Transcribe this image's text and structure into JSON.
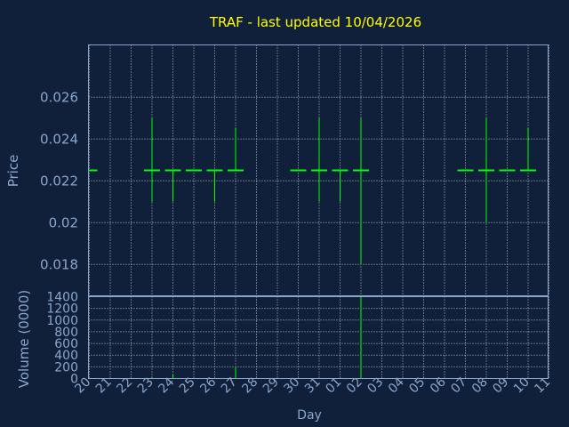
{
  "chart_data": {
    "type": "ohlc",
    "title": "TRAF - last updated 10/04/2026",
    "xlabel": "Day",
    "colors": {
      "background": "#10203a",
      "title": "#ffff00",
      "axis_text": "#8aa6cc",
      "price": "#00ff00",
      "volume": "#00ff00",
      "grid": "#d0d8e4"
    },
    "grid": true,
    "x_tick_labels": [
      "20",
      "21",
      "22",
      "23",
      "24",
      "25",
      "26",
      "27",
      "28",
      "29",
      "30",
      "31",
      "01",
      "02",
      "03",
      "04",
      "05",
      "06",
      "07",
      "08",
      "09",
      "10",
      "11"
    ],
    "price_panel": {
      "ylabel": "Price",
      "ylim": [
        0.0165,
        0.0285
      ],
      "y_ticks": [
        0.018,
        0.02,
        0.022,
        0.024,
        0.026
      ],
      "y_tick_labels": [
        "0.018",
        "0.02",
        "0.022",
        "0.024",
        "0.026"
      ],
      "bars": [
        {
          "x": "20",
          "open": 0.0225,
          "high": 0.0225,
          "low": 0.0225,
          "close": 0.0225
        },
        {
          "x": "23",
          "open": 0.0225,
          "high": 0.025,
          "low": 0.021,
          "close": 0.0225
        },
        {
          "x": "24",
          "open": 0.0225,
          "high": 0.0225,
          "low": 0.021,
          "close": 0.0225
        },
        {
          "x": "25",
          "open": 0.0225,
          "high": 0.0225,
          "low": 0.0225,
          "close": 0.0225
        },
        {
          "x": "26",
          "open": 0.0225,
          "high": 0.0225,
          "low": 0.021,
          "close": 0.0225
        },
        {
          "x": "27",
          "open": 0.0225,
          "high": 0.0245,
          "low": 0.0225,
          "close": 0.0225
        },
        {
          "x": "30",
          "open": 0.0225,
          "high": 0.0225,
          "low": 0.0225,
          "close": 0.0225
        },
        {
          "x": "31",
          "open": 0.0225,
          "high": 0.025,
          "low": 0.021,
          "close": 0.0225
        },
        {
          "x": "01",
          "open": 0.0225,
          "high": 0.0225,
          "low": 0.021,
          "close": 0.0225
        },
        {
          "x": "02",
          "open": 0.0225,
          "high": 0.025,
          "low": 0.018,
          "close": 0.0225
        },
        {
          "x": "07",
          "open": 0.0225,
          "high": 0.0225,
          "low": 0.0225,
          "close": 0.0225
        },
        {
          "x": "08",
          "open": 0.0225,
          "high": 0.025,
          "low": 0.02,
          "close": 0.0225
        },
        {
          "x": "09",
          "open": 0.0225,
          "high": 0.0225,
          "low": 0.0225,
          "close": 0.0225
        },
        {
          "x": "10",
          "open": 0.0225,
          "high": 0.0245,
          "low": 0.0225,
          "close": 0.0225
        }
      ]
    },
    "volume_panel": {
      "ylabel": "Volume (0000)",
      "ylim": [
        0,
        1400
      ],
      "y_ticks": [
        0,
        200,
        400,
        600,
        800,
        1000,
        1200,
        1400
      ],
      "y_tick_labels": [
        "0",
        "200",
        "400",
        "600",
        "800",
        "1000",
        "1200",
        "1400"
      ],
      "bars": [
        {
          "x": "23",
          "value": 20
        },
        {
          "x": "24",
          "value": 80
        },
        {
          "x": "27",
          "value": 200
        },
        {
          "x": "02",
          "value": 1400
        }
      ]
    }
  }
}
